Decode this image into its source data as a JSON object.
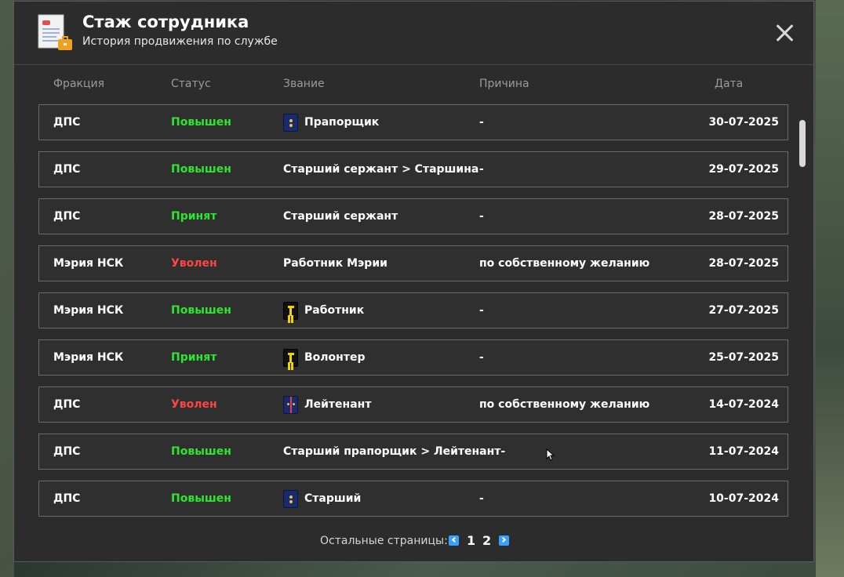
{
  "header": {
    "title": "Стаж сотрудника",
    "subtitle": "История продвижения по службе"
  },
  "columns": {
    "faction": "Фракция",
    "status": "Статус",
    "rank": "Звание",
    "reason": "Причина",
    "date": "Дата"
  },
  "rows": [
    {
      "faction": "ДПС",
      "status": "Повышен",
      "status_color": "green",
      "rank_icon": "dps-shoulder-icon",
      "rank": "Прапорщик",
      "reason": "-",
      "date": "30-07-2025"
    },
    {
      "faction": "ДПС",
      "status": "Повышен",
      "status_color": "green",
      "rank_icon": "",
      "rank": "Старший сержант > Старшина",
      "reason": "-",
      "date": "29-07-2025"
    },
    {
      "faction": "ДПС",
      "status": "Принят",
      "status_color": "green",
      "rank_icon": "",
      "rank": "Старший сержант",
      "reason": "-",
      "date": "28-07-2025"
    },
    {
      "faction": "Мэрия НСК",
      "status": "Уволен",
      "status_color": "red",
      "rank_icon": "",
      "rank": "Работник Мэрии",
      "reason": "по собственному желанию",
      "date": "28-07-2025"
    },
    {
      "faction": "Мэрия НСК",
      "status": "Повышен",
      "status_color": "green",
      "rank_icon": "city-hall-shoulder-icon",
      "rank": "Работник",
      "reason": "-",
      "date": "27-07-2025"
    },
    {
      "faction": "Мэрия НСК",
      "status": "Принят",
      "status_color": "green",
      "rank_icon": "city-hall-shoulder-icon",
      "rank": "Волонтер",
      "reason": "-",
      "date": "25-07-2025"
    },
    {
      "faction": "ДПС",
      "status": "Уволен",
      "status_color": "red",
      "rank_icon": "lieutenant-shoulder-icon",
      "rank": "Лейтенант",
      "reason": "по собственному желанию",
      "date": "14-07-2024"
    },
    {
      "faction": "ДПС",
      "status": "Повышен",
      "status_color": "green",
      "rank_icon": "",
      "rank": "Старший прапорщик > Лейтенант-",
      "reason": "",
      "date": "11-07-2024"
    },
    {
      "faction": "ДПС",
      "status": "Повышен",
      "status_color": "green",
      "rank_icon": "dps-shoulder-icon",
      "rank": "Старший",
      "reason": "-",
      "date": "10-07-2024"
    }
  ],
  "pager": {
    "label": "Остальные страницы:",
    "pages": [
      "1",
      "2"
    ]
  },
  "colors": {
    "green": "#2ee62e",
    "red": "#ff4444",
    "panel": "#2c2c2c",
    "accent": "#3aa0ff"
  }
}
